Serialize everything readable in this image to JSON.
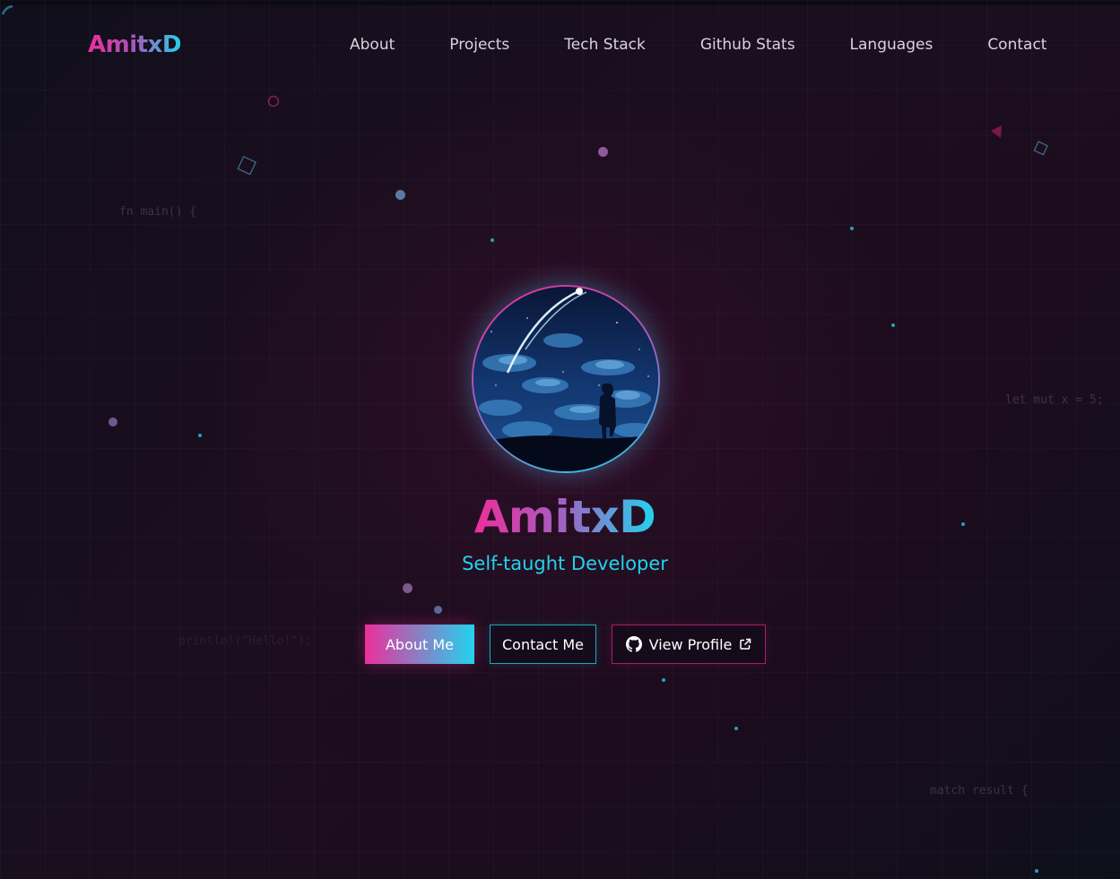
{
  "brand": {
    "logo_text": "AmitxD"
  },
  "nav": {
    "links": [
      "About",
      "Projects",
      "Tech Stack",
      "Github Stats",
      "Languages",
      "Contact"
    ]
  },
  "background_code": {
    "snippets": [
      "fn main() {",
      "let mut x = 5;",
      "println!(\"Hello!\");",
      "match result {"
    ]
  },
  "hero": {
    "name": "AmitxD",
    "subtitle": "Self-taught Developer",
    "avatar_icon": "night-sky-comet-avatar"
  },
  "actions": {
    "about_label": "About Me",
    "contact_label": "Contact Me",
    "profile_label": "View Profile",
    "profile_icon": "github-icon",
    "external_icon": "external-link-icon"
  },
  "colors": {
    "accent_pink": "#ec2f9c",
    "accent_cyan": "#22d3ee",
    "background": "#120d1a"
  }
}
